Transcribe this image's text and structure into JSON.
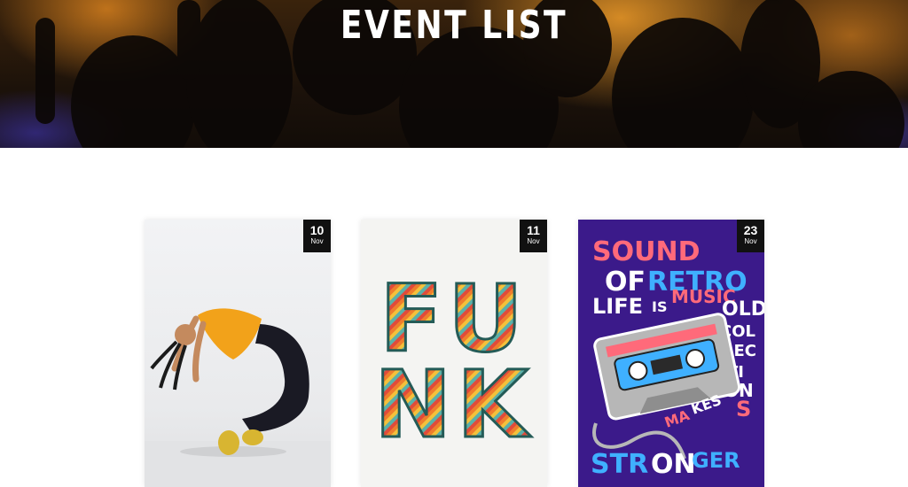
{
  "hero": {
    "title": "Event List"
  },
  "events": [
    {
      "day": "10",
      "month": "Nov",
      "image": "dancer-photo"
    },
    {
      "day": "11",
      "month": "Nov",
      "image": "funk-poster",
      "poster_text": "FUNK"
    },
    {
      "day": "23",
      "month": "Nov",
      "image": "retro-cassette-poster",
      "poster_lines": [
        "SOUND",
        "OF",
        "RETRO",
        "LIFE",
        "IS",
        "MUSIC",
        "OLD",
        "COL",
        "LEC",
        "TI",
        "ON",
        "MA",
        "KES",
        "S",
        "STRONGER"
      ]
    }
  ]
}
